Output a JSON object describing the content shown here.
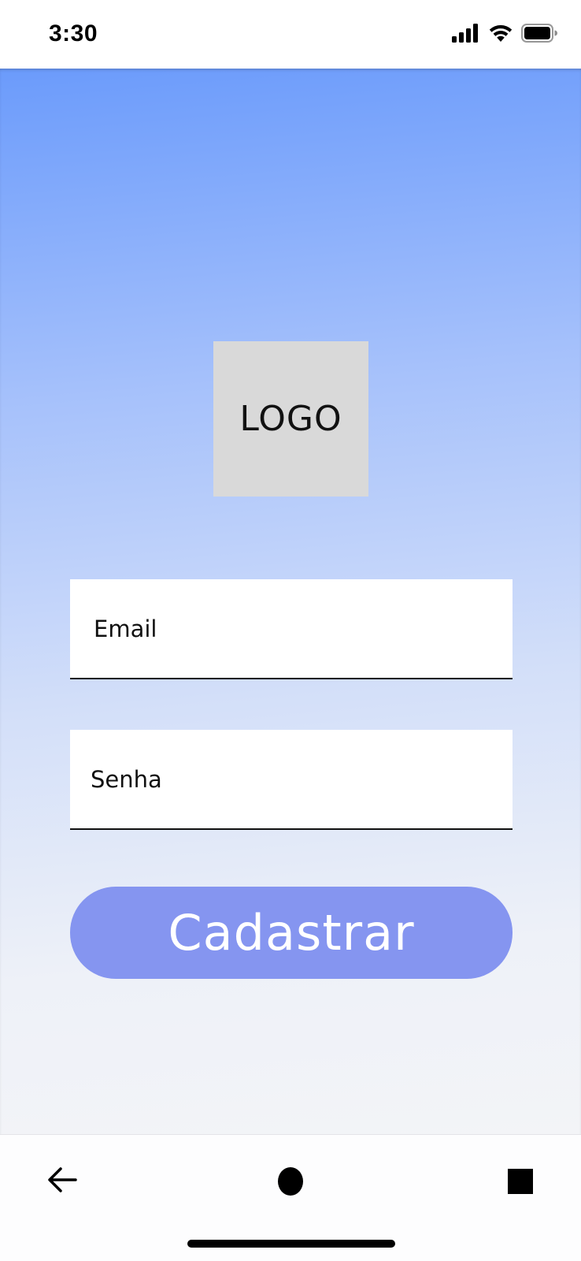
{
  "status_bar": {
    "time": "3:30",
    "icons": [
      "cellular-signal-icon",
      "wifi-icon",
      "battery-icon"
    ]
  },
  "login_form": {
    "logo_text": "LOGO",
    "email_placeholder": "Email",
    "password_placeholder": "Senha",
    "submit_label": "Cadastrar"
  },
  "nav_bar": {
    "icons": [
      "back-arrow-icon",
      "home-icon",
      "recents-icon"
    ]
  },
  "colors": {
    "gradient_top": "#6b9bfb",
    "gradient_bottom": "#f3f4f7",
    "button": "#8595f0",
    "logo_placeholder": "#d9d9d9"
  }
}
